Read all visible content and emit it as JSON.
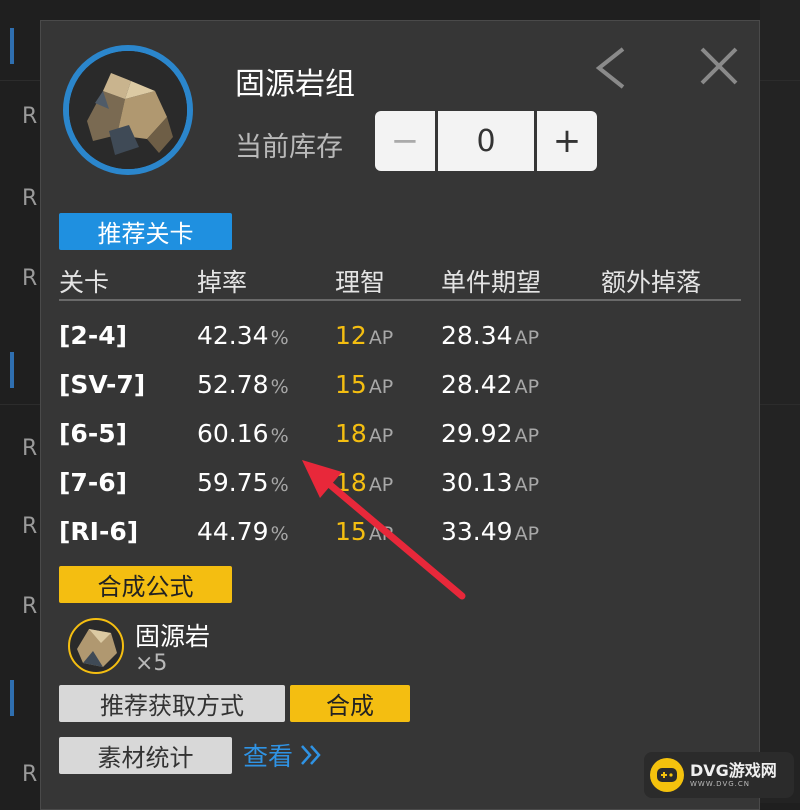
{
  "background": {
    "row_letters": [
      "R",
      "R",
      "R",
      "R",
      "R",
      "R",
      "R"
    ]
  },
  "item": {
    "name": "固源岩组",
    "stock_label": "当前库存",
    "stock_value": "0",
    "minus": "−",
    "plus": "+",
    "icon": "rock-cluster-icon"
  },
  "recommended_stages": {
    "tag": "推荐关卡",
    "columns": [
      "关卡",
      "掉率",
      "理智",
      "单件期望",
      "额外掉落"
    ],
    "rows": [
      {
        "stage": "[2-4]",
        "rate": "42.34",
        "rate_unit": "%",
        "sanity": "12",
        "sanity_unit": "AP",
        "expect": "28.34",
        "expect_unit": "AP"
      },
      {
        "stage": "[SV-7]",
        "rate": "52.78",
        "rate_unit": "%",
        "sanity": "15",
        "sanity_unit": "AP",
        "expect": "28.42",
        "expect_unit": "AP"
      },
      {
        "stage": "[6-5]",
        "rate": "60.16",
        "rate_unit": "%",
        "sanity": "18",
        "sanity_unit": "AP",
        "expect": "29.92",
        "expect_unit": "AP"
      },
      {
        "stage": "[7-6]",
        "rate": "59.75",
        "rate_unit": "%",
        "sanity": "18",
        "sanity_unit": "AP",
        "expect": "30.13",
        "expect_unit": "AP"
      },
      {
        "stage": "[RI-6]",
        "rate": "44.79",
        "rate_unit": "%",
        "sanity": "15",
        "sanity_unit": "AP",
        "expect": "33.49",
        "expect_unit": "AP"
      }
    ]
  },
  "formula": {
    "tag": "合成公式",
    "material_name": "固源岩",
    "material_qty": "×5"
  },
  "actions": {
    "recommend_label": "推荐获取方式",
    "synthesize_label": "合成",
    "stats_label": "素材统计",
    "view_label": "查看"
  },
  "watermark": {
    "brand": "DVG游戏网",
    "sub": "WWW.DVG.CN"
  },
  "colors": {
    "accent_blue": "#1f90e0",
    "accent_yellow": "#f4be11",
    "annotation_red": "#e8283a"
  }
}
